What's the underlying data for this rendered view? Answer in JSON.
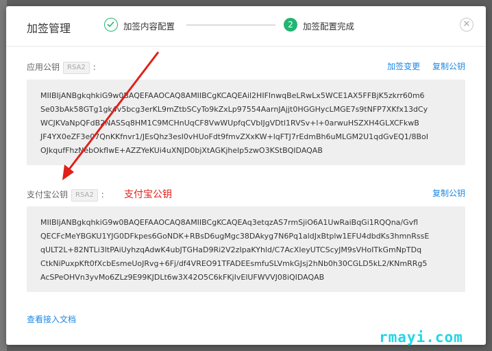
{
  "modal": {
    "title": "加签管理",
    "close_icon": "close-icon",
    "steps": [
      {
        "label": "加签内容配置",
        "status": "done",
        "icon": "check-icon"
      },
      {
        "number": "2",
        "label": "加签配置完成",
        "status": "active"
      }
    ],
    "app_key": {
      "label": "应用公钥",
      "badge": "RSA2",
      "colon": ":",
      "actions": [
        "加签变更",
        "复制公钥"
      ],
      "lines": [
        "MIIBIjANBgkqhkiG9w0BAQEFAAOCAQ8AMIIBCgKCAQEAil2HIFInwqBeLRwLx5WCE1AX5FFBjK5zkrr60m6",
        "Se03bAk58GTg1gk4v5bcg3erKL9mZtbSCyTo9kZxLp97554AarnJAjjt0HGGHycLMGE7s9tNFP7XKfx13dCy",
        "WCJKVaNpQFdB2NASSq8HM1C9MCHnUqCF8VwWUpfqCVbIJgVDtl1RVSv+l+0arwuHSZXH4GLXCFkwB",
        "JF4YX0eZF3e07QnKKfnvr1/JEsQhz3esI0vHUoFdt9fmvZXxKW+lqFTJ7rEdmBh6uMLGM2U1qdGvEQ1/8BoI",
        "OJkqufFhzNebOkflwE+AZZYeKUi4uXNJD0bjXtAGKjhelp5zwO3KStBQIDAQAB"
      ]
    },
    "alipay_key": {
      "label": "支付宝公钥",
      "badge": "RSA2",
      "colon": ":",
      "actions": [
        "复制公钥"
      ],
      "annotation": "支付宝公钥",
      "lines": [
        "MIIBIjANBgkqhkiG9w0BAQEFAAOCAQ8AMIIBCgKCAQEAq3etqzAS7rmSjiO6A1UwRaiBqGi1RQQna/Gvfl",
        "QECFcMeYBGKU1YJG0DFkpes6GoNDK+RBsD6ugMgc38DAkyg7N6Pq1aldJxBtplw1EFU4dbdKs3hmnRssE",
        "qULT2L+82NTLi3ltPAiUyhzqAdwK4ubJTGHaD9Ri2V2zIpaKYhld/C7AcXIeyUTCScyJM9sVHoITkGmNpTDq",
        "CtkNiPuxpKft0fXcbEsmeUoJRvg+6Fj/df4VREO91TFADEEsmfuSLVmkGJsj2hNb0h30CGLD5kL2/KNmRRg5",
        "AcSPeOHVn3yvMo6ZLz9E99KJDLt6w3X42O5C6kFKjIvElUFWVVJ08iQIDAQAB"
      ]
    },
    "doc_link": "查看接入文档"
  },
  "watermark": "rmayi.com",
  "colors": {
    "accent": "#1e88e5",
    "success": "#22b573",
    "annotation": "#e0201a"
  }
}
